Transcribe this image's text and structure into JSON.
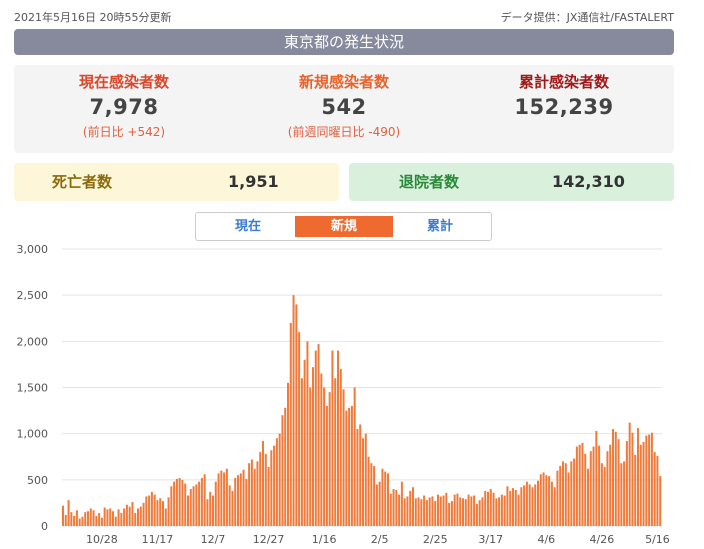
{
  "header": {
    "updated": "2021年5月16日 20時55分更新",
    "source": "データ提供：JX通信社/FASTALERT"
  },
  "banner": {
    "title": "東京都の発生状況"
  },
  "stats": {
    "current": {
      "label": "現在感染者数",
      "value": "7,978",
      "sub": "(前日比 +542)",
      "color": "#d9482b"
    },
    "new": {
      "label": "新規感染者数",
      "value": "542",
      "sub": "(前週同曜日比 -490)",
      "color": "#e8622c"
    },
    "total": {
      "label": "累計感染者数",
      "value": "152,239",
      "color": "#a01818"
    }
  },
  "deaths": {
    "label": "死亡者数",
    "value": "1,951"
  },
  "recovered": {
    "label": "退院者数",
    "value": "142,310"
  },
  "tabs": {
    "current": "現在",
    "new": "新規",
    "total": "累計",
    "active": "new"
  },
  "colors": {
    "bar": "#ef7a3a",
    "accent": "#ef6a2e",
    "tab_text": "#3a7bd5"
  },
  "chart_data": {
    "type": "bar",
    "ylim": [
      0,
      3000
    ],
    "yticks": [
      0,
      500,
      1000,
      1500,
      2000,
      2500,
      3000
    ],
    "ytick_labels": [
      "0",
      "500",
      "1,000",
      "1,500",
      "2,000",
      "2,500",
      "3,000"
    ],
    "xtick_labels": [
      "10/28",
      "11/17",
      "12/7",
      "12/27",
      "1/16",
      "2/5",
      "2/25",
      "3/17",
      "4/6",
      "4/26",
      "5/16"
    ],
    "xtick_index": [
      14,
      34,
      54,
      74,
      94,
      114,
      134,
      154,
      174,
      194,
      214
    ],
    "values": [
      220,
      120,
      280,
      150,
      110,
      170,
      80,
      100,
      150,
      160,
      190,
      170,
      110,
      140,
      90,
      200,
      180,
      190,
      160,
      100,
      180,
      140,
      190,
      230,
      210,
      260,
      140,
      190,
      210,
      250,
      320,
      330,
      370,
      340,
      280,
      300,
      270,
      190,
      310,
      430,
      480,
      510,
      520,
      500,
      460,
      330,
      400,
      430,
      450,
      480,
      520,
      560,
      290,
      370,
      330,
      480,
      570,
      600,
      580,
      620,
      440,
      380,
      520,
      550,
      570,
      610,
      510,
      680,
      720,
      620,
      700,
      800,
      920,
      780,
      640,
      820,
      870,
      950,
      1000,
      1200,
      1280,
      1550,
      2200,
      2500,
      2400,
      2100,
      1600,
      1800,
      2000,
      1500,
      1720,
      1900,
      1970,
      1650,
      1500,
      1300,
      1450,
      1900,
      1600,
      1900,
      1700,
      1480,
      1250,
      1280,
      1300,
      1500,
      1050,
      1100,
      950,
      1000,
      750,
      680,
      650,
      450,
      480,
      620,
      590,
      570,
      350,
      400,
      390,
      340,
      480,
      300,
      320,
      380,
      420,
      300,
      310,
      290,
      330,
      280,
      310,
      320,
      270,
      340,
      320,
      330,
      360,
      250,
      270,
      340,
      350,
      310,
      300,
      290,
      340,
      320,
      330,
      240,
      280,
      310,
      380,
      370,
      400,
      360,
      300,
      310,
      340,
      330,
      430,
      380,
      410,
      390,
      340,
      420,
      440,
      480,
      450,
      420,
      450,
      490,
      560,
      580,
      550,
      540,
      480,
      420,
      600,
      650,
      700,
      680,
      580,
      700,
      730,
      860,
      880,
      900,
      780,
      620,
      810,
      860,
      1030,
      870,
      680,
      640,
      810,
      880,
      1050,
      1020,
      940,
      680,
      700,
      920,
      1120,
      1010,
      770,
      1060,
      880,
      910,
      980,
      990,
      1010,
      800,
      760,
      540
    ]
  }
}
